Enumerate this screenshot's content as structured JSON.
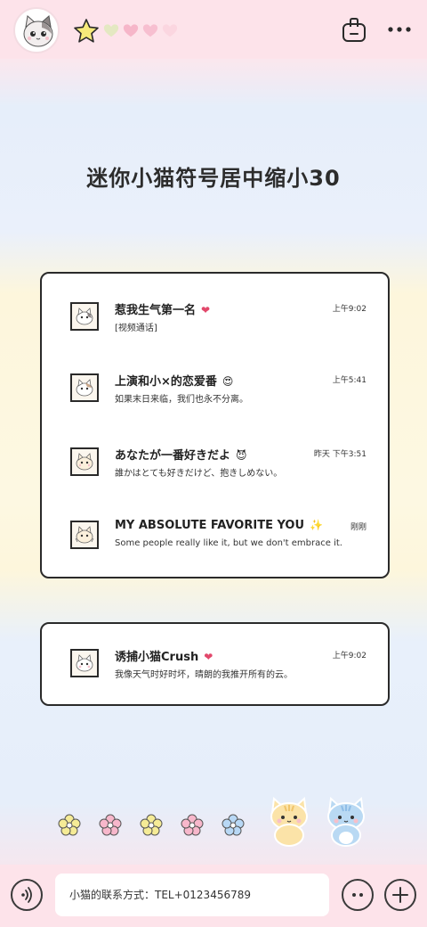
{
  "header": {
    "avatar_icon": "cat-face-icon",
    "rating": {
      "filled": 1,
      "total": 5
    },
    "colors": {
      "star": "#f7ea7a",
      "heart_green": "#e6ebc4",
      "heart_pink": "#f7b8cb"
    }
  },
  "title": "迷你小猫符号居中缩小30",
  "chats": [
    {
      "name": "惹我生气第一名",
      "emoji": "❤",
      "message": "[视频通话]",
      "time": "上午9:02",
      "emoji_color": "#e2486b"
    },
    {
      "name": "上演和小×的恋爱番",
      "emoji": "😍",
      "message": "如果末日来临，我们也永不分离。",
      "time": "上午5:41",
      "emoji_color": "#f5a623"
    },
    {
      "name": "あなたが一番好きだよ",
      "emoji": "😈",
      "message": "誰かはとても好きだけど、抱きしめない。",
      "time": "昨天 下午3:51",
      "emoji_color": "#7b3fb3"
    },
    {
      "name": "MY ABSOLUTE FAVORITE YOU",
      "emoji": "✨",
      "message": "Some people really like it, but we don't embrace it.",
      "time": "刚刚",
      "emoji_color": "#f1c232"
    }
  ],
  "pinned_chat": {
    "name": "诱捕小猫Crush",
    "emoji": "❤",
    "message": "我像天气时好时坏，晴朗的我推开所有的云。",
    "time": "上午9:02",
    "emoji_color": "#e2486b"
  },
  "bottom": {
    "contact_text": "小猫的联系方式：TEL+0123456789"
  },
  "flower_colors": [
    "#f5eb96",
    "#f7b7cb",
    "#f5eb96",
    "#f7b7cb",
    "#b8d8f5"
  ]
}
